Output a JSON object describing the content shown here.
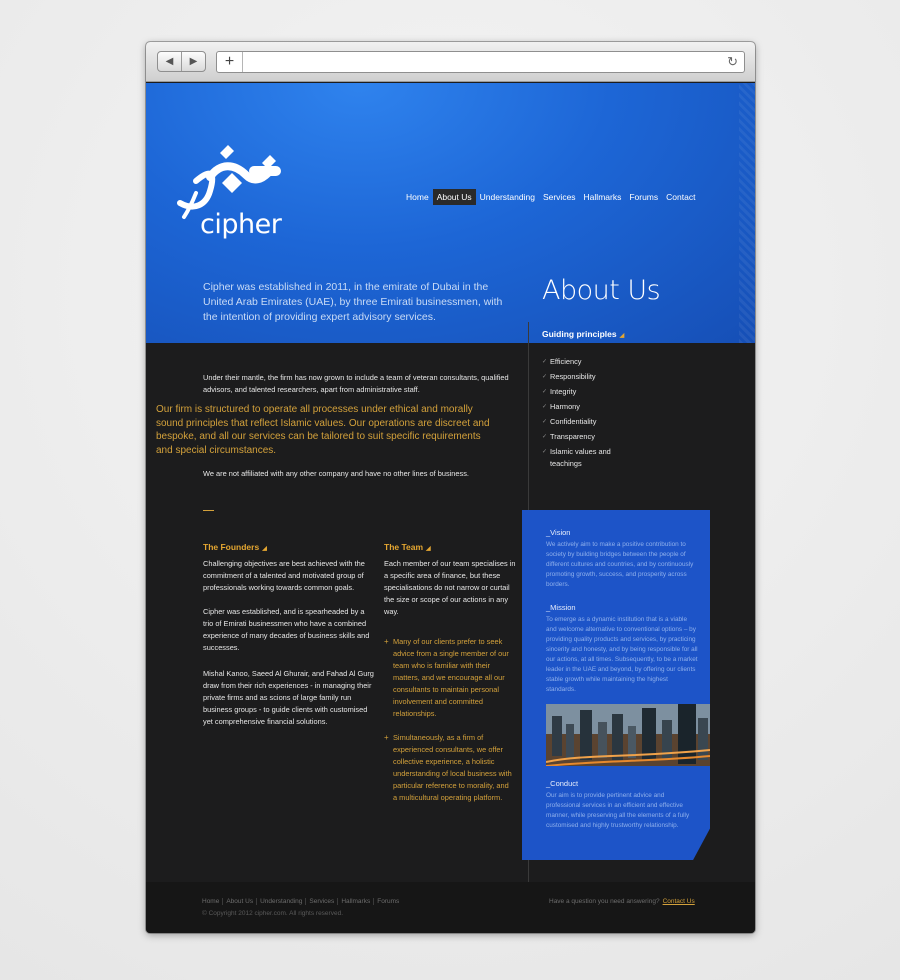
{
  "browser": {
    "back_icon": "back-arrow-icon",
    "forward_icon": "forward-arrow-icon",
    "plus": "+",
    "reload_icon": "reload-icon"
  },
  "site": {
    "logo_text": "cipher",
    "nav": [
      "Home",
      "About Us",
      "Understanding",
      "Services",
      "Hallmarks",
      "Forums",
      "Contact"
    ],
    "active_nav": "About Us",
    "intro": "Cipher was established in 2011, in the emirate of Dubai in the United Arab Emirates (UAE), by three Emirati businessmen, with the intention of providing expert advisory services.",
    "page_title": "About Us"
  },
  "main": {
    "p1": "Under their mantle, the firm has now grown to include a team of veteran consultants, qualified advisors, and talented researchers, apart from administrative staff.",
    "highlight": "Our firm is structured to operate all processes under ethical and morally sound principles that reflect Islamic values. Our operations are discreet and bespoke, and all our services can be tailored to suit specific requirements and special circumstances.",
    "p2": "We are not affiliated with any other company and have no other lines of business.",
    "founders": {
      "heading": "The Founders",
      "p1": "Challenging objectives are best achieved with the commitment of a talented and motivated group of professionals working towards common goals.",
      "p2": "Cipher was established, and is spearheaded by a trio of Emirati businessmen who have a combined experience of many decades of business skills and successes.",
      "p3": "Mishal Kanoo, Saeed Al Ghurair, and Fahad Al Gurg draw from their rich experiences - in managing their private firms and as scions of large family run business groups - to guide clients with customised yet comprehensive financial solutions."
    },
    "team": {
      "heading": "The Team",
      "p1": "Each member of our team specialises in a specific area of finance, but these specialisations do not narrow or curtail the size or scope of our actions in any way.",
      "bullets": [
        "Many of our clients prefer to seek advice from a single member of our team who is familiar with their matters, and we encourage all our consultants to maintain personal involvement and committed relationships.",
        "Simultaneously, as a firm of experienced consultants, we offer collective experience, a holistic understanding of local business with particular reference to morality, and a multicultural operating platform."
      ]
    }
  },
  "sidebar": {
    "heading": "Guiding principles",
    "items": [
      "Efficiency",
      "Responsibility",
      "Integrity",
      "Harmony",
      "Confidentiality",
      "Transparency",
      "Islamic values and teachings"
    ],
    "vision_head": "_Vision",
    "vision": "We actively aim to make a positive contribution to society by building bridges between the people of different cultures and countries, and by continuously promoting growth, success, and prosperity across borders.",
    "mission_head": "_Mission",
    "mission": "To emerge as a dynamic institution that is a viable and welcome alternative to conventional options – by providing quality products and services, by practicing sincerity and honesty, and by being responsible for all our actions, at all times. Subsequently, to be a market leader in the UAE and beyond, by offering our clients stable growth while maintaining the highest standards.",
    "conduct_head": "_Conduct",
    "conduct": "Our aim is to provide pertinent advice and professional services in an efficient and effective manner, while preserving all the elements of a fully customised and highly trustworthy relationship."
  },
  "footer": {
    "links": [
      "Home",
      "About Us",
      "Understanding",
      "Services",
      "Hallmarks",
      "Forums"
    ],
    "copyright": "© Copyright 2012 cipher.com. All rights reserved.",
    "question": "Have a question you need answering?",
    "contact": "Contact Us"
  },
  "colors": {
    "blue": "#1d66d6",
    "gold": "#d3a13b",
    "dark": "#1c1c1d"
  }
}
